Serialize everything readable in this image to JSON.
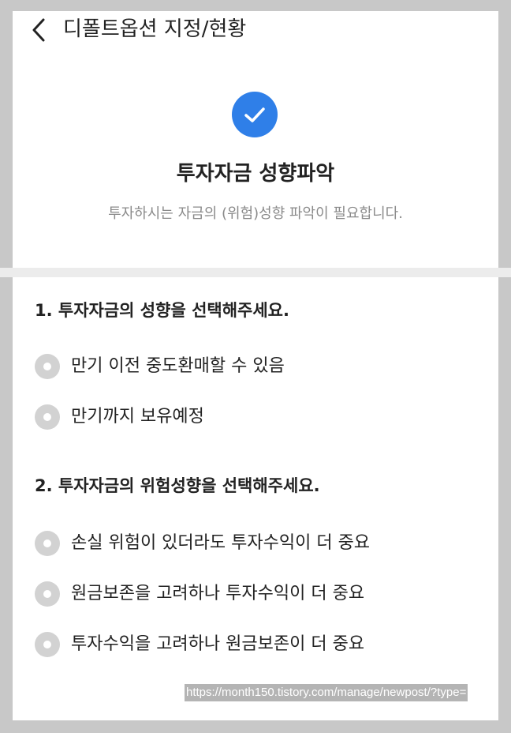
{
  "header": {
    "title": "디폴트옵션 지정/현황"
  },
  "hero": {
    "title": "투자자금 성향파악",
    "subtitle": "투자하시는 자금의 (위험)성향 파악이 필요합니다."
  },
  "questions": [
    {
      "title": "1. 투자자금의 성향을 선택해주세요.",
      "options": [
        {
          "label": "만기 이전 중도환매할 수 있음",
          "selected": false
        },
        {
          "label": "만기까지 보유예정",
          "selected": false
        }
      ]
    },
    {
      "title": "2. 투자자금의 위험성향을 선택해주세요.",
      "options": [
        {
          "label": "손실 위험이 있더라도 투자수익이 더 중요",
          "selected": false
        },
        {
          "label": "원금보존을 고려하나 투자수익이 더 중요",
          "selected": false
        },
        {
          "label": "투자수익을 고려하나 원금보존이 더 중요",
          "selected": false
        }
      ]
    }
  ],
  "watermark": {
    "url": "https://month150.tistory.com/manage/newpost/?type="
  },
  "icons": {
    "back": "chevron-left-icon",
    "complete": "check-circle-icon",
    "radio": "radio-unselected-icon"
  },
  "colors": {
    "accent": "#2f7fe8",
    "radio_unselected": "#d2d2d2",
    "divider": "#ececec",
    "subtitle_text": "#8a8a8a"
  }
}
